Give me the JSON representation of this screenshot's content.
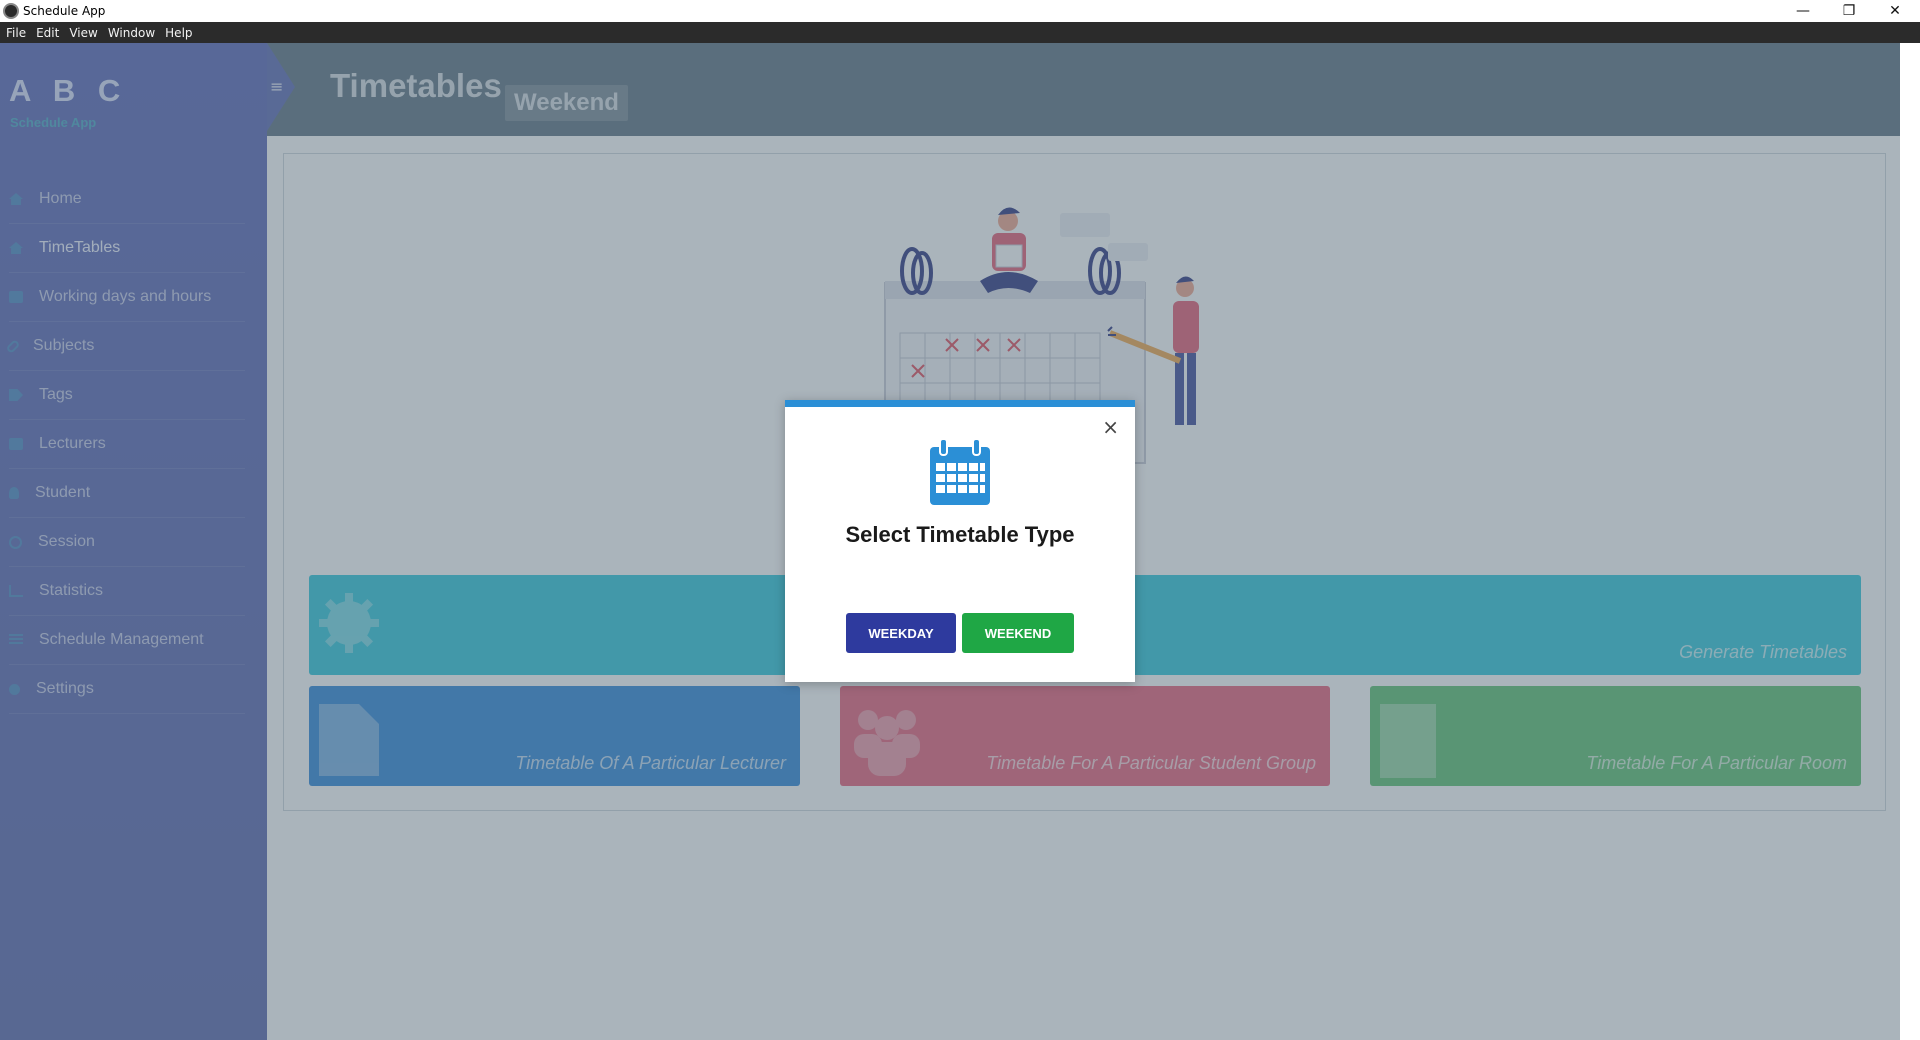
{
  "window": {
    "title": "Schedule App",
    "minimize_glyph": "—",
    "restore_glyph": "❐",
    "close_glyph": "✕"
  },
  "menu": [
    "File",
    "Edit",
    "View",
    "Window",
    "Help"
  ],
  "sidebar": {
    "brand": "A B C",
    "brand_sub": "Schedule App",
    "toggle_glyph": "≡",
    "items": [
      {
        "label": "Home",
        "icon": "home-icon"
      },
      {
        "label": "TimeTables",
        "icon": "home-icon",
        "active": true
      },
      {
        "label": "Working days and hours",
        "icon": "briefcase-icon"
      },
      {
        "label": "Subjects",
        "icon": "paperclip-icon"
      },
      {
        "label": "Tags",
        "icon": "tag-icon"
      },
      {
        "label": "Lecturers",
        "icon": "briefcase-icon"
      },
      {
        "label": "Student",
        "icon": "user-icon"
      },
      {
        "label": "Session",
        "icon": "globe-icon"
      },
      {
        "label": "Statistics",
        "icon": "line-chart-icon"
      },
      {
        "label": "Schedule Management",
        "icon": "list-icon"
      },
      {
        "label": "Settings",
        "icon": "cogs-icon"
      }
    ]
  },
  "header": {
    "title": "Timetables",
    "badge": "Weekend"
  },
  "cards": {
    "generate": "Generate Timetables",
    "lecturer": "Timetable Of A Particular Lecturer",
    "student": "Timetable For A Particular Student Group",
    "room": "Timetable For A Particular Room"
  },
  "modal": {
    "title": "Select Timetable Type",
    "close_glyph": "×",
    "weekday_label": "WEEKDAY",
    "weekend_label": "WEEKEND"
  },
  "colors": {
    "sidebar": "#5a67b8",
    "header": "#5f7382",
    "modal_accent": "#2b8fd6",
    "weekday_button": "#2e3a9e",
    "weekend_button": "#1fa745",
    "card_generate": "#2fc7da",
    "card_lecturer": "#2f86d8",
    "card_student": "#e8617a",
    "card_room": "#5dc071"
  }
}
